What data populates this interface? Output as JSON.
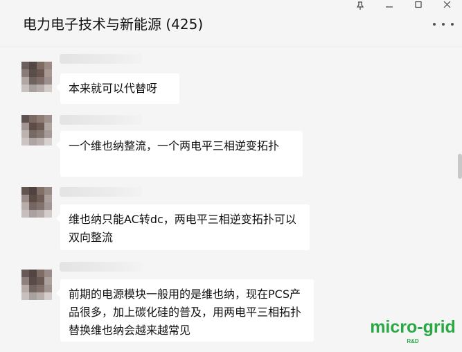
{
  "window": {
    "controls": [
      "pin-icon",
      "minimize-icon",
      "maximize-icon",
      "close-icon"
    ]
  },
  "header": {
    "title": "电力电子技术与新能源 (425)",
    "more_icon": "more-icon"
  },
  "messages": [
    {
      "text": "本来就可以代替呀"
    },
    {
      "text": "一个维也纳整流，一个两电平三相逆变拓扑"
    },
    {
      "text": "维也纳只能AC转dc，两电平三相逆变拓扑可以双向整流"
    },
    {
      "text": "前期的电源模块一般用的是维也纳，现在PCS产品很多，加上碳化硅的普及，用两电平三相拓扑替换维也纳会越来越常见"
    }
  ],
  "watermark": {
    "main": "micro-grid",
    "sub": "R&D",
    "color": "#2aa845"
  },
  "colors": {
    "background": "#f5f5f5",
    "bubble": "#ffffff"
  }
}
